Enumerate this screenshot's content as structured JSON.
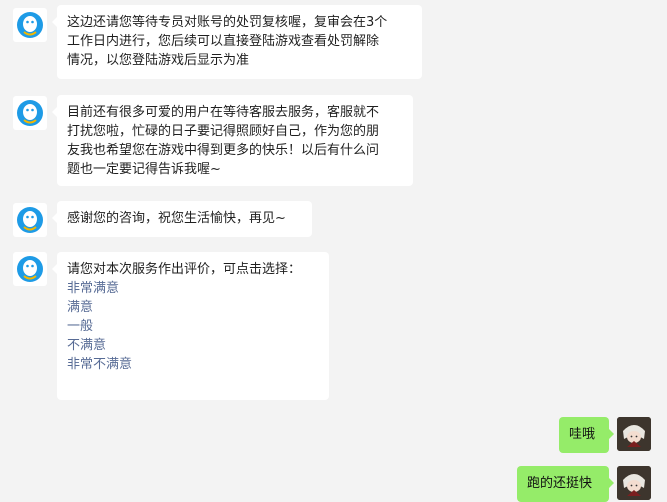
{
  "messages": {
    "m1": {
      "line1": "这边还请您等待专员对账号的处罚复核喔，复审会在3个",
      "line2": "工作日内进行，您后续可以直接登陆游戏查看处罚解除",
      "line3": "情况，以您登陆游戏后显示为准"
    },
    "m2": {
      "line1": "目前还有很多可爱的用户在等待客服去服务，客服就不",
      "line2": "打扰您啦，忙碌的日子要记得照顾好自己，作为您的朋",
      "line3": "友我也希望您在游戏中得到更多的快乐！以后有什么问",
      "line4": "题也一定要记得告诉我喔~"
    },
    "m3": {
      "text": "感谢您的咨询，祝您生活愉快，再见~"
    },
    "m4": {
      "prompt": "请您对本次服务作出评价，可点击选择：",
      "options": [
        "非常满意",
        "满意",
        "一般",
        "不满意",
        "非常不满意"
      ]
    },
    "u1": {
      "text": "哇哦"
    },
    "u2": {
      "text": "跑的还挺快"
    }
  },
  "colors": {
    "background": "#f3f3f3",
    "incoming_bubble": "#ffffff",
    "outgoing_bubble": "#95ec69",
    "option_link": "#576b95",
    "bot_avatar_accent": "#1e9be6"
  }
}
